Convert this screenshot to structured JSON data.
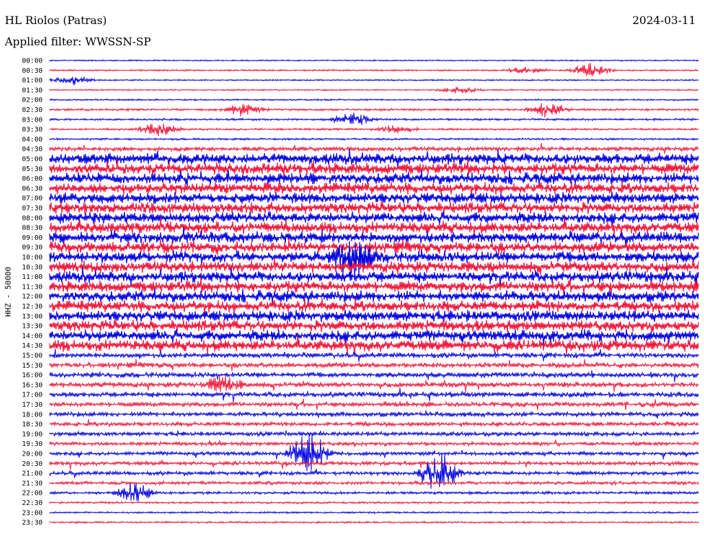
{
  "header": {
    "station": "HL Riolos (Patras)",
    "filter": "Applied filter: WWSSN-SP",
    "date": "2024-03-11"
  },
  "chart_data": {
    "type": "line",
    "title": "HL Riolos (Patras)",
    "ylabel": "HHZ - 50000",
    "trace_colors": [
      "#0000e0",
      "#f0163a"
    ],
    "tick_labels": [
      "00:00",
      "00:30",
      "01:00",
      "01:30",
      "02:00",
      "02:30",
      "03:00",
      "03:30",
      "04:00",
      "04:30",
      "05:00",
      "05:30",
      "06:00",
      "06:30",
      "07:00",
      "07:30",
      "08:00",
      "08:30",
      "09:00",
      "09:30",
      "10:00",
      "10:30",
      "11:00",
      "11:30",
      "12:00",
      "12:30",
      "13:00",
      "13:30",
      "14:00",
      "14:30",
      "15:00",
      "15:30",
      "16:00",
      "16:30",
      "17:00",
      "17:30",
      "18:00",
      "18:30",
      "19:00",
      "19:30",
      "20:00",
      "20:30",
      "21:00",
      "21:30",
      "22:00",
      "22:30",
      "23:00",
      "23:30"
    ],
    "activity_level": [
      0.05,
      0.08,
      0.06,
      0.06,
      0.08,
      0.15,
      0.12,
      0.12,
      0.12,
      0.35,
      1.0,
      1.0,
      1.0,
      1.0,
      1.0,
      1.0,
      1.0,
      1.0,
      1.0,
      1.0,
      1.0,
      1.0,
      1.0,
      1.0,
      1.0,
      1.0,
      1.0,
      1.0,
      1.0,
      1.0,
      0.45,
      0.45,
      0.45,
      0.45,
      0.45,
      0.4,
      0.4,
      0.35,
      0.35,
      0.3,
      0.3,
      0.3,
      0.3,
      0.25,
      0.2,
      0.12,
      0.1,
      0.1
    ],
    "events": [
      {
        "row": 1,
        "minute": 22,
        "amplitude": 0.5
      },
      {
        "row": 1,
        "minute": 25,
        "amplitude": 1.0
      },
      {
        "row": 2,
        "minute": 1,
        "amplitude": 0.7
      },
      {
        "row": 3,
        "minute": 19,
        "amplitude": 0.5
      },
      {
        "row": 5,
        "minute": 9,
        "amplitude": 1.0
      },
      {
        "row": 5,
        "minute": 23,
        "amplitude": 1.0
      },
      {
        "row": 6,
        "minute": 14,
        "amplitude": 1.0
      },
      {
        "row": 7,
        "minute": 5,
        "amplitude": 1.0
      },
      {
        "row": 7,
        "minute": 16,
        "amplitude": 0.6
      },
      {
        "row": 20,
        "minute": 14,
        "amplitude": 3.0
      },
      {
        "row": 33,
        "minute": 8,
        "amplitude": 1.2
      },
      {
        "row": 40,
        "minute": 12,
        "amplitude": 3.0
      },
      {
        "row": 42,
        "minute": 18,
        "amplitude": 3.0
      },
      {
        "row": 44,
        "minute": 4,
        "amplitude": 1.5
      }
    ]
  }
}
